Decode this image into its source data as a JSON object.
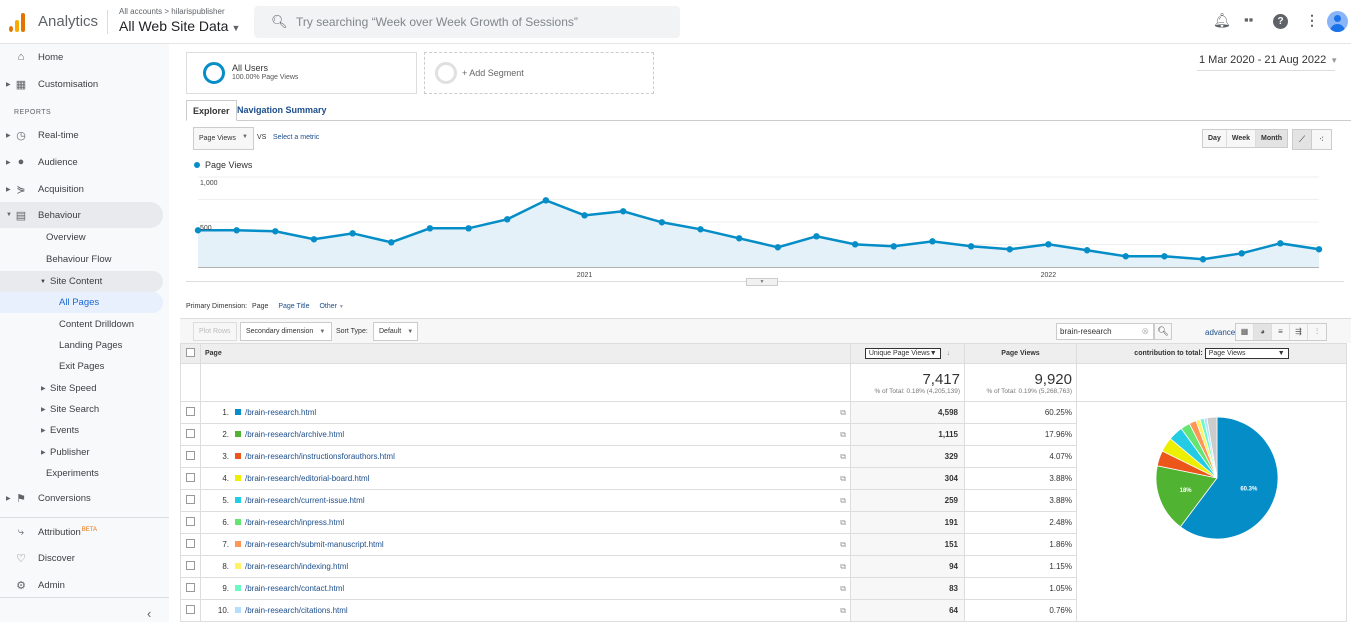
{
  "topbar": {
    "app_name": "Analytics",
    "breadcrumb": "All accounts > hilarispublisher",
    "property": "All Web Site Data",
    "search_placeholder": "Try searching “Week over Week Growth of Sessions”",
    "icons": [
      "bell-icon",
      "apps-icon",
      "help-icon",
      "more-vert-icon",
      "avatar"
    ]
  },
  "sidebar": {
    "top_items": [
      {
        "label": "Home",
        "icon": "home-icon"
      },
      {
        "label": "Customisation",
        "icon": "dashboard-icon"
      }
    ],
    "reports_label": "REPORTS",
    "report_items": [
      {
        "label": "Real-time",
        "icon": "clock-icon"
      },
      {
        "label": "Audience",
        "icon": "person-icon"
      },
      {
        "label": "Acquisition",
        "icon": "acquisition-icon"
      },
      {
        "label": "Behaviour",
        "icon": "behaviour-icon"
      }
    ],
    "behaviour_children": [
      "Overview",
      "Behaviour Flow",
      "Site Content"
    ],
    "site_content_children": [
      "All Pages",
      "Content Drilldown",
      "Landing Pages",
      "Exit Pages"
    ],
    "behaviour_more": [
      "Site Speed",
      "Site Search",
      "Events",
      "Publisher",
      "Experiments"
    ],
    "conversions": "Conversions",
    "bottom_items": [
      {
        "label": "Attribution",
        "badge": "BETA",
        "icon": "attribution-icon"
      },
      {
        "label": "Discover",
        "icon": "lightbulb-icon"
      },
      {
        "label": "Admin",
        "icon": "gear-icon"
      }
    ],
    "collapse_icon": "‹"
  },
  "segments": {
    "active": {
      "name": "All Users",
      "detail": "100.00% Page Views"
    },
    "add_label": "+ Add Segment"
  },
  "date_range": "1 Mar 2020 - 21 Aug 2022",
  "tabs": [
    "Explorer",
    "Navigation Summary"
  ],
  "chart_controls": {
    "metric": "Page Views",
    "vs": "VS",
    "select_metric": "Select a metric",
    "periods": [
      "Day",
      "Week",
      "Month"
    ],
    "active_period": "Month"
  },
  "chart_data": {
    "type": "area",
    "title": "",
    "legend": [
      "Page Views"
    ],
    "legend_position": "top-left",
    "series": [
      {
        "name": "Page Views",
        "color": "#058dc7",
        "values": [
          408,
          408,
          397,
          308,
          374,
          274,
          430,
          430,
          530,
          741,
          574,
          619,
          497,
          419,
          319,
          219,
          341,
          252,
          230,
          285,
          230,
          197,
          252,
          186,
          119,
          119,
          86,
          152,
          263,
          197
        ]
      }
    ],
    "x": [
      "Mar 2020",
      "Apr 2020",
      "May 2020",
      "Jun 2020",
      "Jul 2020",
      "Aug 2020",
      "Sep 2020",
      "Oct 2020",
      "Nov 2020",
      "Dec 2020",
      "Jan 2021",
      "Feb 2021",
      "Mar 2021",
      "Apr 2021",
      "May 2021",
      "Jun 2021",
      "Jul 2021",
      "Aug 2021",
      "Sep 2021",
      "Oct 2021",
      "Nov 2021",
      "Dec 2021",
      "Jan 2022",
      "Feb 2022",
      "Mar 2022",
      "Apr 2022",
      "May 2022",
      "Jun 2022",
      "Jul 2022",
      "Aug 2022"
    ],
    "x_tick_labels": [
      {
        "index": 10,
        "label": "2021"
      },
      {
        "index": 22,
        "label": "2022"
      }
    ],
    "y_ticks": [
      {
        "value": 500,
        "label": "500"
      },
      {
        "value": 1000,
        "label": "1,000"
      }
    ],
    "ylim": [
      0,
      1000
    ],
    "grid": true,
    "xlabel": "",
    "ylabel": ""
  },
  "dimensions": {
    "label": "Primary Dimension:",
    "current": "Page",
    "options": [
      "Page Title",
      "Other"
    ]
  },
  "table_toolbar": {
    "plot_rows": "Plot Rows",
    "secondary_dimension": "Secondary dimension",
    "sort_type_label": "Sort Type:",
    "sort_type_value": "Default",
    "filter_value": "brain-research",
    "advanced": "advanced"
  },
  "table": {
    "col_page": "Page",
    "col_metric_select": "Unique Page Views",
    "col_page_views": "Page Views",
    "contribution_label": "contribution to total:",
    "contribution_metric": "Page Views",
    "totals": {
      "unique_page_views": "7,417",
      "unique_page_views_pct": "% of Total: 0.18% (4,205,139)",
      "page_views": "9,920",
      "page_views_pct": "% of Total: 0.19% (5,268,763)"
    },
    "rows": [
      {
        "rank": "1.",
        "page": "/brain-research.html",
        "color": "#058dc7",
        "unique": "4,598",
        "pct": "60.25%"
      },
      {
        "rank": "2.",
        "page": "/brain-research/archive.html",
        "color": "#50b432",
        "unique": "1,115",
        "pct": "17.96%"
      },
      {
        "rank": "3.",
        "page": "/brain-research/instructionsforauthors.html",
        "color": "#ed561b",
        "unique": "329",
        "pct": "4.07%"
      },
      {
        "rank": "4.",
        "page": "/brain-research/editorial-board.html",
        "color": "#edef00",
        "unique": "304",
        "pct": "3.88%"
      },
      {
        "rank": "5.",
        "page": "/brain-research/current-issue.html",
        "color": "#24cbe5",
        "unique": "259",
        "pct": "3.88%"
      },
      {
        "rank": "6.",
        "page": "/brain-research/inpress.html",
        "color": "#64e572",
        "unique": "191",
        "pct": "2.48%"
      },
      {
        "rank": "7.",
        "page": "/brain-research/submit-manuscript.html",
        "color": "#ff9655",
        "unique": "151",
        "pct": "1.86%"
      },
      {
        "rank": "8.",
        "page": "/brain-research/indexing.html",
        "color": "#fff263",
        "unique": "94",
        "pct": "1.15%"
      },
      {
        "rank": "9.",
        "page": "/brain-research/contact.html",
        "color": "#6af9c4",
        "unique": "83",
        "pct": "1.05%"
      },
      {
        "rank": "10.",
        "page": "/brain-research/citations.html",
        "color": "#b2deff",
        "unique": "64",
        "pct": "0.76%"
      }
    ]
  },
  "pie": {
    "other_color": "#cccccc",
    "labels": [
      "60.3%",
      "18%"
    ]
  }
}
